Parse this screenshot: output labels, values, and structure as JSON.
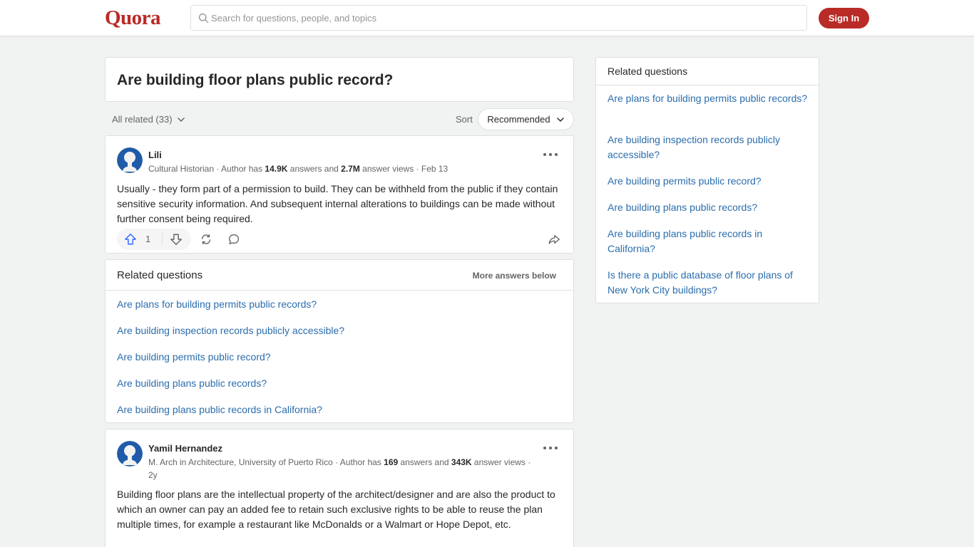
{
  "header": {
    "logo": "Quora",
    "search_placeholder": "Search for questions, people, and topics",
    "signin_label": "Sign In"
  },
  "question": {
    "title": "Are building floor plans public record?"
  },
  "filters": {
    "all_related": "All related (33)",
    "sort_label": "Sort",
    "sort_value": "Recommended"
  },
  "answers": [
    {
      "author": "Lili",
      "credential": "Cultural Historian · Author has ",
      "answers_count": "14.9K",
      "answers_word": " answers and ",
      "views_count": "2.7M",
      "views_word": " answer views · Feb 13",
      "text": "Usually - they form part of a permission to build. They can be withheld from the public if they contain sensitive security information. And subsequent internal alterations to buildings can be made without further consent being required.",
      "upvotes": "1"
    },
    {
      "author": "Yamil Hernandez",
      "credential": "M. Arch in Architecture, University of Puerto Rico · Author has ",
      "answers_count": "169",
      "answers_word": " answers and ",
      "views_count": "343K",
      "views_word": " answer views ·",
      "time": "2y",
      "text": "Building floor plans are the intellectual property of the architect/designer and are also the product to which an owner can pay an added fee to retain such exclusive rights to be able to reuse the plan multiple times, for example a restaurant like McDonalds or a Walmart or Hope Depot, etc."
    }
  ],
  "related_inline": {
    "title": "Related questions",
    "more": "More answers below",
    "items": [
      "Are plans for building permits public records?",
      "Are building inspection records publicly accessible?",
      "Are building permits public record?",
      "Are building plans public records?",
      "Are building plans public records in California?"
    ]
  },
  "sidebar": {
    "title": "Related questions",
    "items": [
      "Are plans for building permits public records?",
      "Are building inspection records publicly accessible?",
      "Are building permits public record?",
      "Are building plans public records?",
      "Are building plans public records in California?",
      "Is there a public database of floor plans of New York City buildings?"
    ]
  },
  "colors": {
    "brand": "#b92b27",
    "link": "#2b6dad",
    "avatar": "#1f5ba8"
  }
}
